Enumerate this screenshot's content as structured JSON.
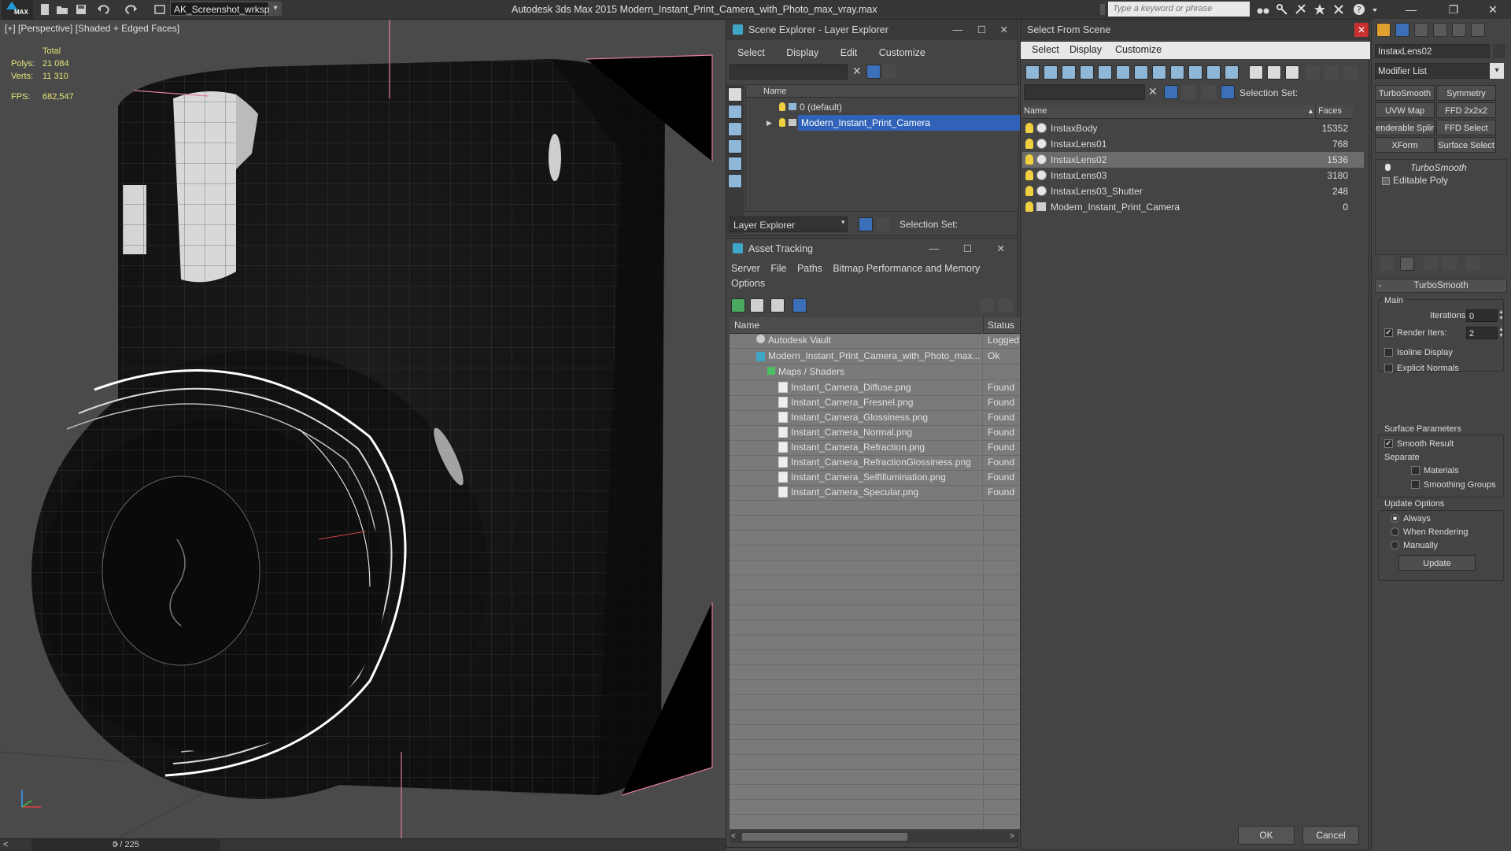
{
  "titlebar": {
    "logo_text": "MAX",
    "workspace": "AK_Screenshot_wrksp",
    "app_title": "Autodesk 3ds Max  2015     Modern_Instant_Print_Camera_with_Photo_max_vray.max",
    "search_placeholder": "Type a keyword or phrase"
  },
  "viewport": {
    "label": "[+] [Perspective] [Shaded + Edged Faces]",
    "stats": {
      "header": "Total",
      "polys_label": "Polys:",
      "polys_value": "21 084",
      "verts_label": "Verts:",
      "verts_value": "11 310",
      "fps_label": "FPS:",
      "fps_value": "682,547"
    },
    "timeline": "0 / 225",
    "colors": {
      "background": "#4a4a4a",
      "model": "#151515",
      "wire": "#8a8a8a",
      "selected_wire": "#ffffff",
      "bbox": "#e07aa8"
    }
  },
  "scene_explorer": {
    "title": "Scene Explorer - Layer Explorer",
    "menu": [
      "Select",
      "Display",
      "Edit",
      "Customize"
    ],
    "column_name": "Name",
    "items": [
      {
        "label": "0 (default)"
      },
      {
        "label": "Modern_Instant_Print_Camera"
      }
    ],
    "footer_dropdown": "Layer Explorer",
    "selection_set_label": "Selection Set:"
  },
  "asset_tracking": {
    "title": "Asset Tracking",
    "menu": [
      "Server",
      "File",
      "Paths",
      "Bitmap Performance and Memory",
      "Options"
    ],
    "col_name": "Name",
    "col_status": "Status",
    "rows": [
      {
        "name": "Autodesk Vault",
        "status": "Logged"
      },
      {
        "name": "Modern_Instant_Print_Camera_with_Photo_max...",
        "status": "Ok"
      },
      {
        "name": "Maps / Shaders",
        "status": ""
      },
      {
        "name": "Instant_Camera_Diffuse.png",
        "status": "Found"
      },
      {
        "name": "Instant_Camera_Fresnel.png",
        "status": "Found"
      },
      {
        "name": "Instant_Camera_Glossiness.png",
        "status": "Found"
      },
      {
        "name": "Instant_Camera_Normal.png",
        "status": "Found"
      },
      {
        "name": "Instant_Camera_Refraction.png",
        "status": "Found"
      },
      {
        "name": "Instant_Camera_RefractionGlossiness.png",
        "status": "Found"
      },
      {
        "name": "Instant_Camera_SelfIllumination.png",
        "status": "Found"
      },
      {
        "name": "Instant_Camera_Specular.png",
        "status": "Found"
      }
    ]
  },
  "select_from_scene": {
    "title": "Select From Scene",
    "menu": [
      "Select",
      "Display",
      "Customize"
    ],
    "selection_set_label": "Selection Set:",
    "col_name": "Name",
    "col_faces": "Faces",
    "rows": [
      {
        "name": "InstaxBody",
        "faces": "15352"
      },
      {
        "name": "InstaxLens01",
        "faces": "768"
      },
      {
        "name": "InstaxLens02",
        "faces": "1536"
      },
      {
        "name": "InstaxLens03",
        "faces": "3180"
      },
      {
        "name": "InstaxLens03_Shutter",
        "faces": "248"
      },
      {
        "name": "Modern_Instant_Print_Camera",
        "faces": "0"
      }
    ],
    "ok": "OK",
    "cancel": "Cancel"
  },
  "command_panel": {
    "object_name": "InstaxLens02",
    "modifier_list": "Modifier List",
    "mod_buttons": [
      "TurboSmooth",
      "Symmetry",
      "UVW Map",
      "FFD 2x2x2",
      "enderable Splir",
      "FFD Select",
      "XForm",
      "Surface Select"
    ],
    "stack": [
      "TurboSmooth",
      "Editable Poly"
    ],
    "rollout_title": "TurboSmooth",
    "main_label": "Main",
    "iterations_label": "Iterations:",
    "iterations_value": "0",
    "render_iters_label": "Render Iters:",
    "render_iters_value": "2",
    "isoline_label": "Isoline Display",
    "explicit_normals_label": "Explicit Normals",
    "surface_params_label": "Surface Parameters",
    "smooth_result_label": "Smooth Result",
    "separate_label": "Separate",
    "materials_label": "Materials",
    "smoothing_groups_label": "Smoothing Groups",
    "update_options_label": "Update Options",
    "always_label": "Always",
    "when_rendering_label": "When Rendering",
    "manually_label": "Manually",
    "update_button": "Update"
  }
}
